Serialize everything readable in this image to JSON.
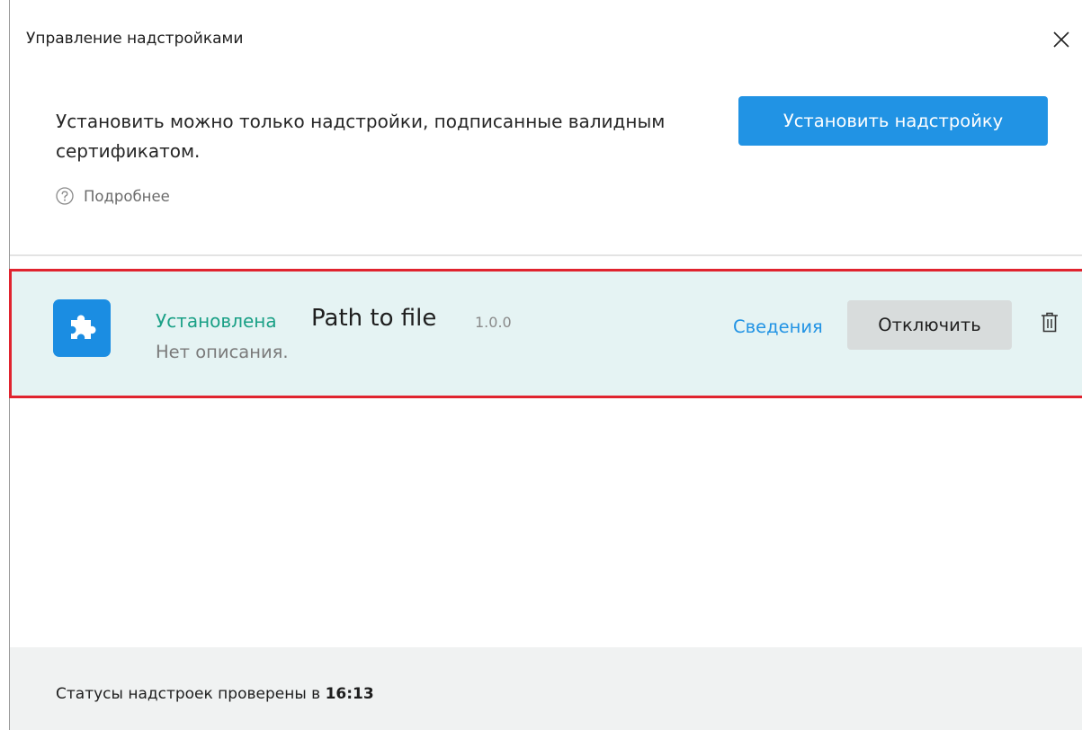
{
  "window": {
    "title": "Управление надстройками"
  },
  "notice": {
    "text": "Установить можно только надстройки, подписанные валидным сертификатом.",
    "more_label": "Подробнее"
  },
  "toolbar": {
    "install_label": "Установить надстройку"
  },
  "addons": [
    {
      "status": "Установлена",
      "name": "Path to file",
      "version": "1.0.0",
      "description": "Нет описания.",
      "details_label": "Сведения",
      "disable_label": "Отключить",
      "icon": "puzzle-icon"
    }
  ],
  "footer": {
    "status_prefix": "Статусы надстроек проверены в",
    "time": "16:13"
  },
  "colors": {
    "accent": "#2193e4",
    "installed_status": "#1aa086",
    "row_background": "#e5f3f3",
    "highlight_border": "#e0232e",
    "secondary_button": "#d8dcdc",
    "footer_background": "#f0f2f2"
  }
}
